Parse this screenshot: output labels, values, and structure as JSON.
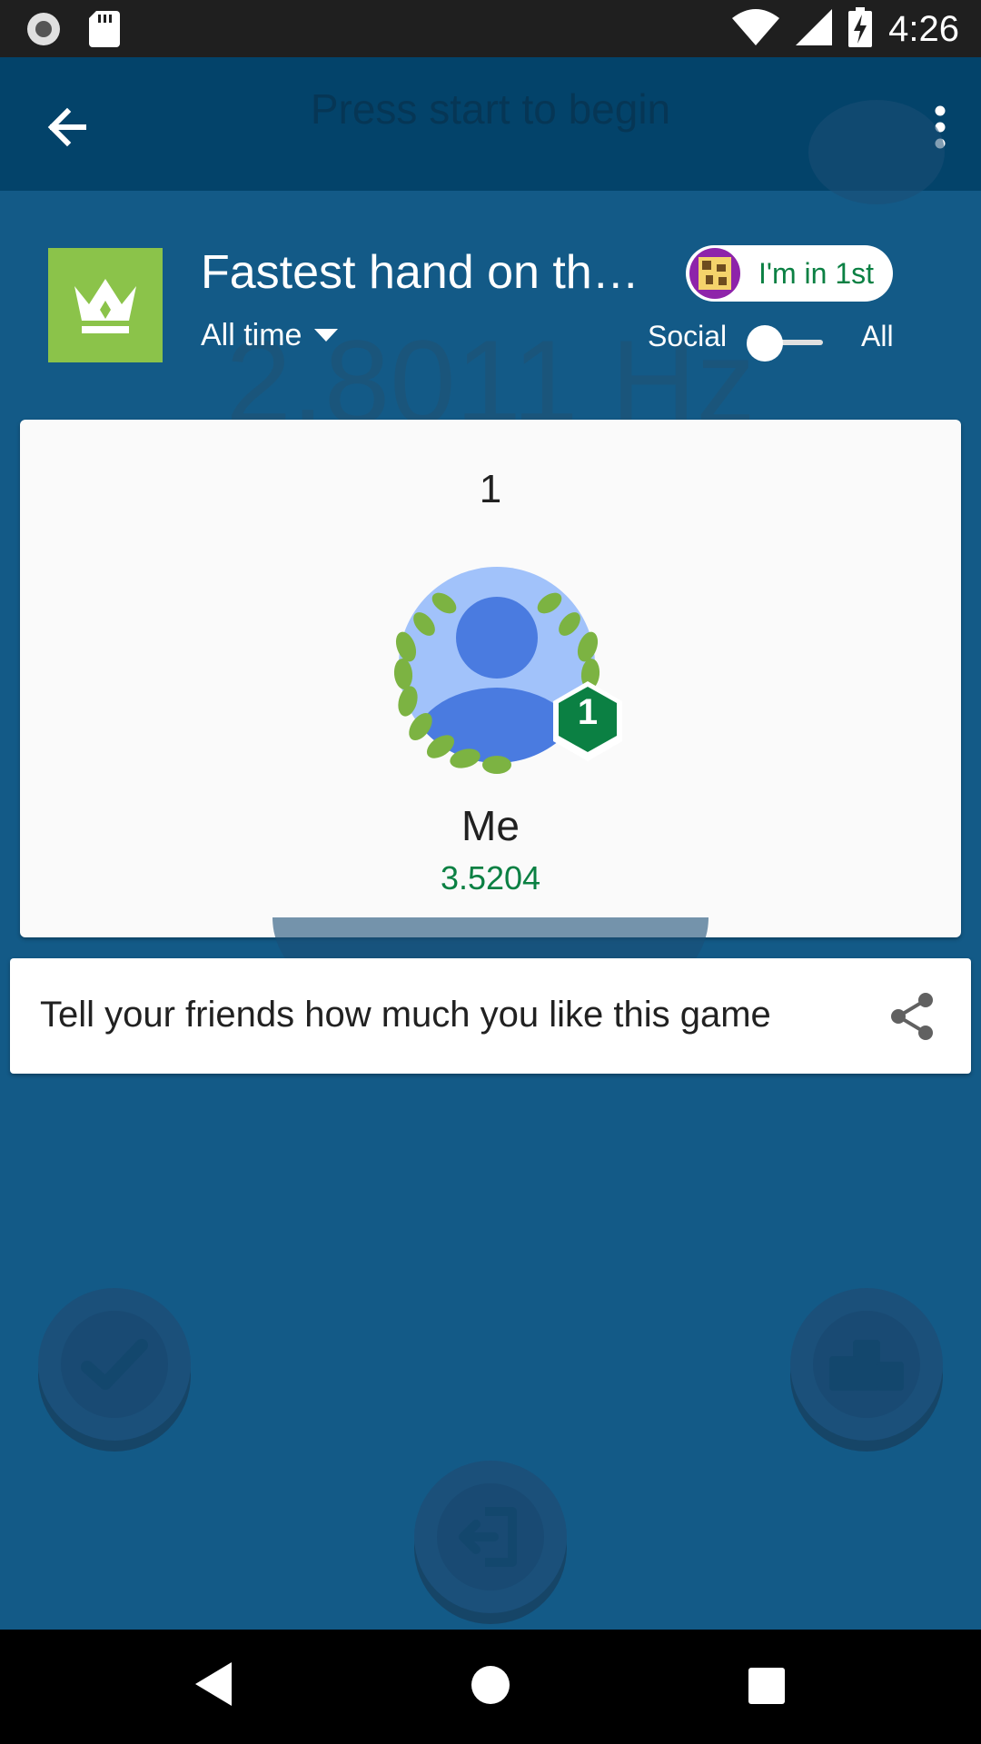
{
  "status_bar": {
    "time": "4:26",
    "icons": [
      "record-icon",
      "sd-card-icon",
      "wifi-icon",
      "signal-icon",
      "battery-charging-icon"
    ]
  },
  "app_bar": {
    "background_title": "Press start to begin",
    "icons": [
      "back-arrow-icon",
      "more-vert-icon"
    ]
  },
  "background": {
    "frequency_readout": "2.8011 Hz"
  },
  "leaderboard": {
    "title": "Fastest hand on th…",
    "time_filter": "All time",
    "rank_badge": "I'm in 1st",
    "toggle_left_label": "Social",
    "toggle_right_label": "All",
    "toggle_state": "social",
    "entry": {
      "rank": "1",
      "rank_badge": "1",
      "name": "Me",
      "score": "3.5204"
    }
  },
  "share_bar": {
    "text": "Tell your friends how much you like this game",
    "icon": "share-icon"
  },
  "background_buttons": [
    "check-icon",
    "podium-icon",
    "exit-icon"
  ],
  "nav_bar": {
    "buttons": [
      "back-triangle-icon",
      "home-circle-icon",
      "recents-square-icon"
    ]
  },
  "colors": {
    "app_bar": "#03436a",
    "overlay_background": "#135a87",
    "crown_tile": "#8bc34a",
    "score_green": "#0b8043",
    "rank_hex": "#0b8043",
    "avatar_light": "#a1c2fa",
    "avatar_dark": "#4a7be0"
  }
}
